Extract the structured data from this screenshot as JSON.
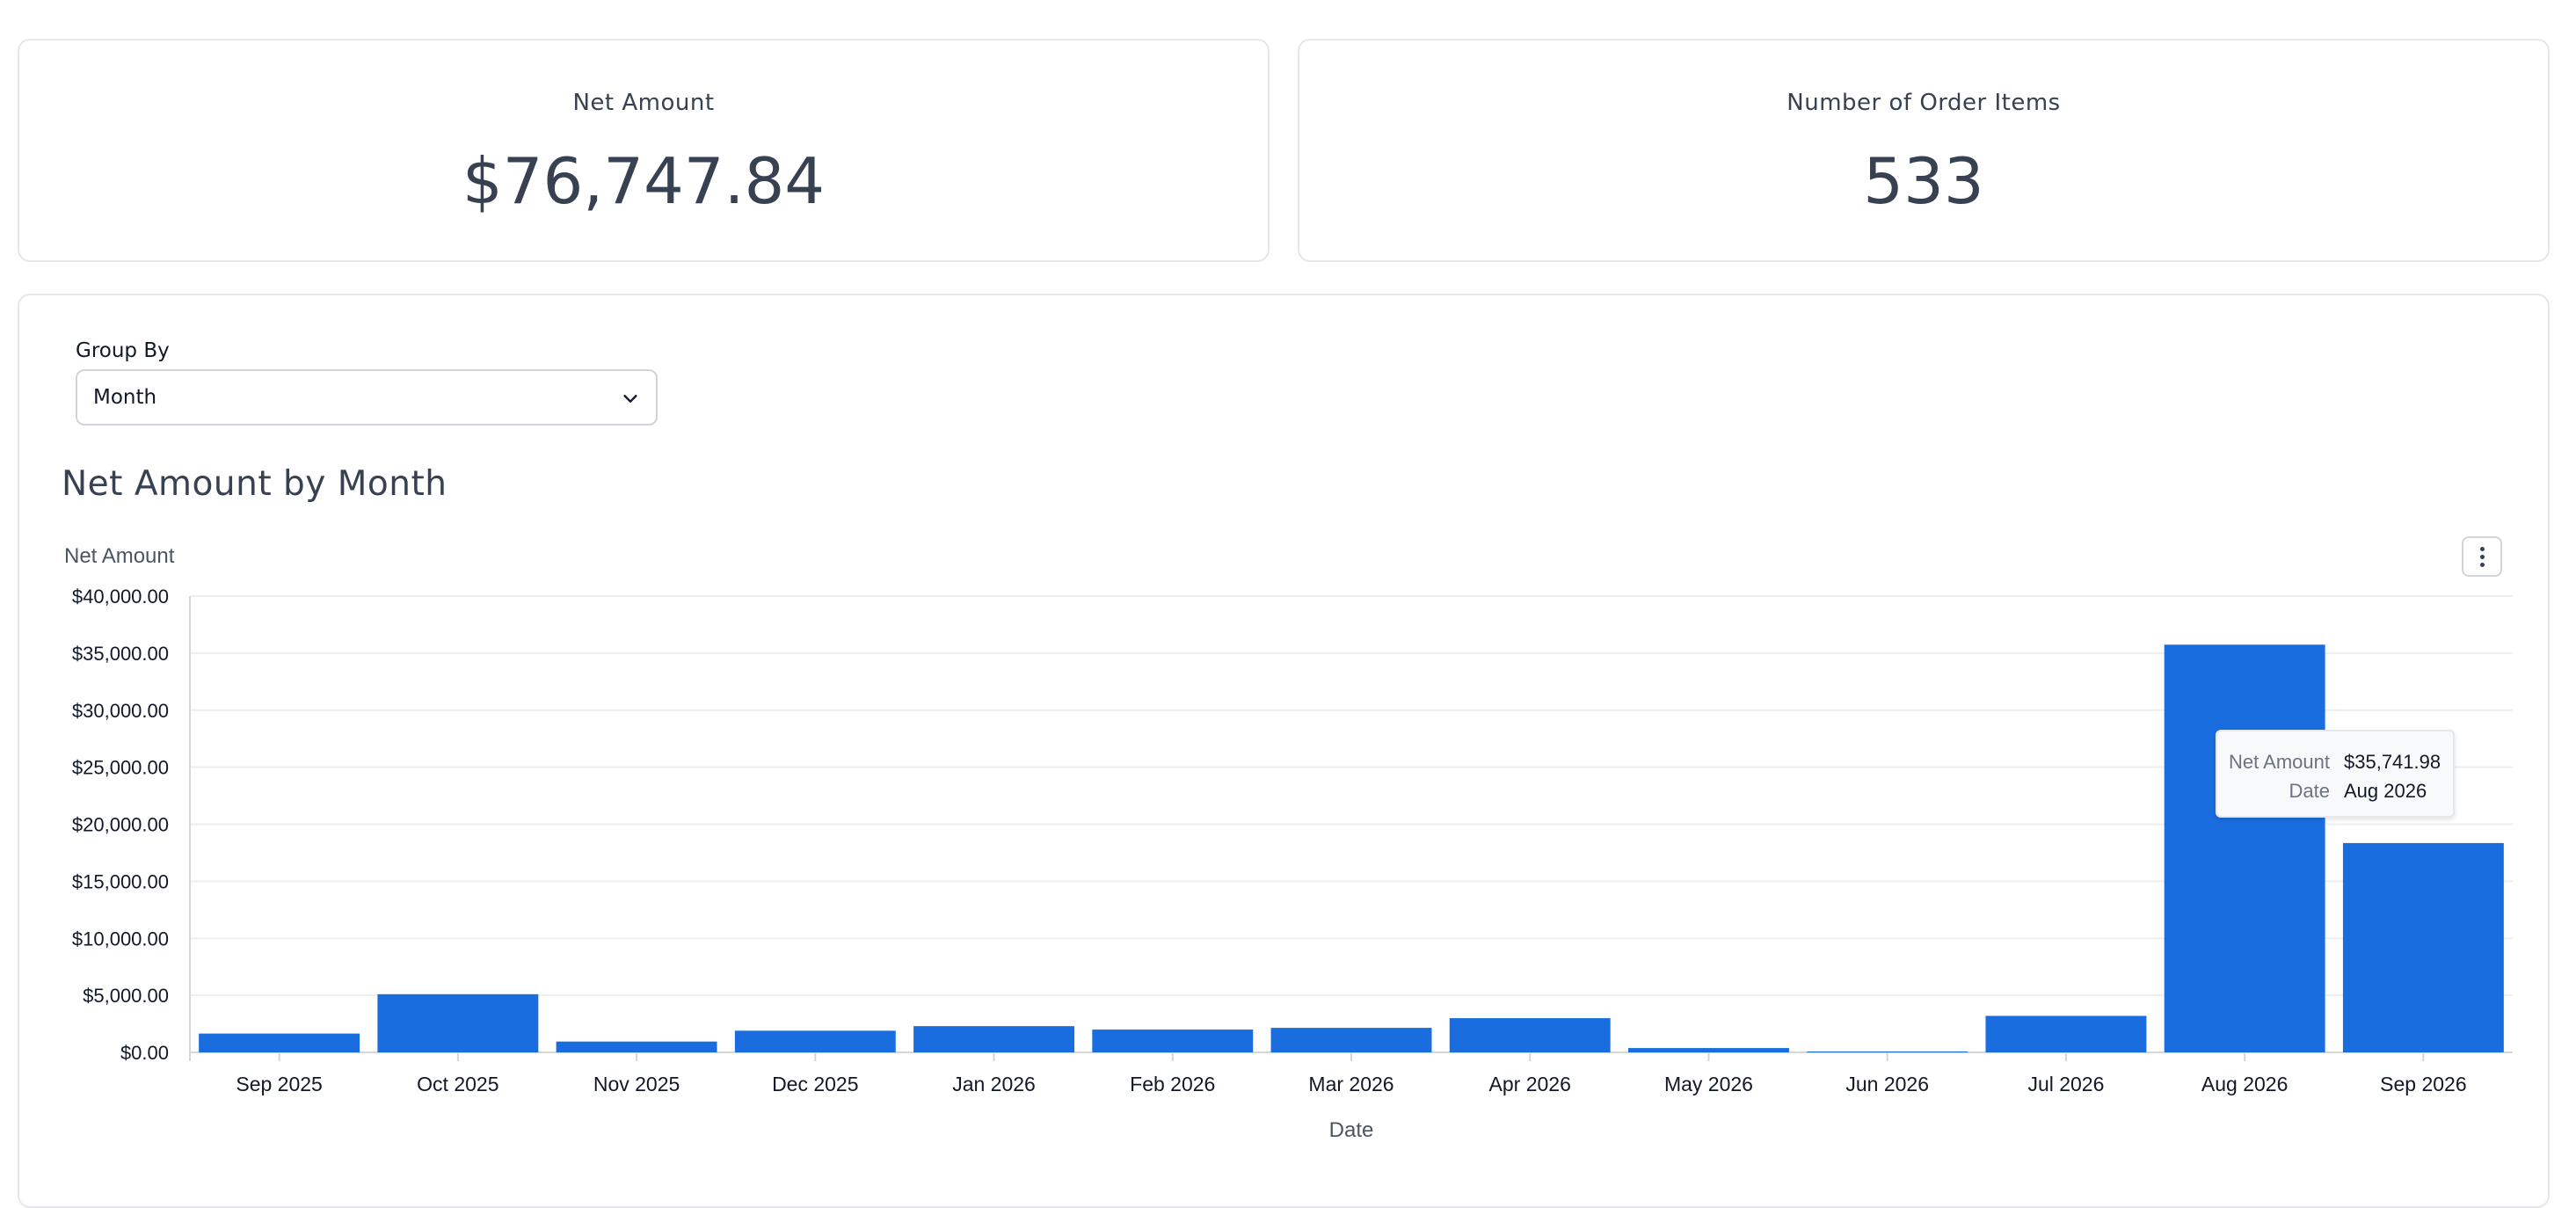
{
  "kpis": {
    "net_amount": {
      "label": "Net Amount",
      "value": "$76,747.84"
    },
    "order_items": {
      "label": "Number of Order Items",
      "value": "533"
    }
  },
  "controls": {
    "group_by_label": "Group By",
    "group_by_value": "Month"
  },
  "chart_card": {
    "title": "Net Amount by Month"
  },
  "tooltip": {
    "series_label": "Net Amount",
    "series_value": "$35,741.98",
    "date_label": "Date",
    "date_value": "Aug 2026"
  },
  "colors": {
    "bar": "#1a6ddf",
    "grid": "#eeeeee",
    "axis": "#d6d6d6"
  },
  "icons": [
    "chevron-down-icon",
    "more-vertical-icon"
  ],
  "chart_data": {
    "type": "bar",
    "xlabel": "Date",
    "ylabel": "Net Amount",
    "ylim": [
      0,
      40000
    ],
    "yticks": [
      "$0.00",
      "$5,000.00",
      "$10,000.00",
      "$15,000.00",
      "$20,000.00",
      "$25,000.00",
      "$30,000.00",
      "$35,000.00",
      "$40,000.00"
    ],
    "grid": true,
    "categories": [
      "Sep 2025",
      "Oct 2025",
      "Nov 2025",
      "Dec 2025",
      "Jan 2026",
      "Feb 2026",
      "Mar 2026",
      "Apr 2026",
      "May 2026",
      "Jun 2026",
      "Jul 2026",
      "Aug 2026",
      "Sep 2026"
    ],
    "series": [
      {
        "values": [
          1650,
          5100,
          950,
          1900,
          2300,
          2000,
          2150,
          3000,
          380,
          80,
          3200,
          35741.98,
          18350
        ]
      }
    ]
  }
}
